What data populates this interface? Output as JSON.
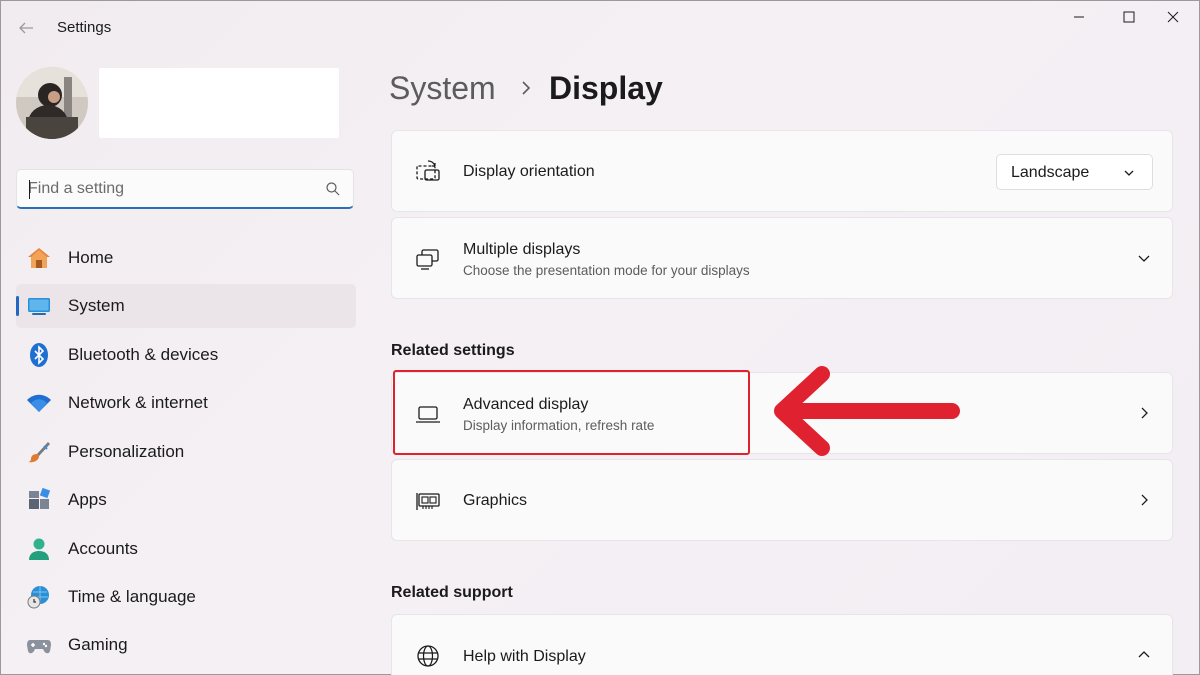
{
  "window": {
    "title": "Settings"
  },
  "search": {
    "placeholder": "Find a setting"
  },
  "sidebar": {
    "items": [
      {
        "label": "Home",
        "icon": "home-icon"
      },
      {
        "label": "System",
        "icon": "system-icon",
        "active": true
      },
      {
        "label": "Bluetooth & devices",
        "icon": "bluetooth-icon"
      },
      {
        "label": "Network & internet",
        "icon": "wifi-icon"
      },
      {
        "label": "Personalization",
        "icon": "brush-icon"
      },
      {
        "label": "Apps",
        "icon": "apps-icon"
      },
      {
        "label": "Accounts",
        "icon": "person-icon"
      },
      {
        "label": "Time & language",
        "icon": "globe-clock-icon"
      },
      {
        "label": "Gaming",
        "icon": "gamepad-icon"
      }
    ]
  },
  "breadcrumb": {
    "parent": "System",
    "current": "Display"
  },
  "cards": {
    "orientation": {
      "title": "Display orientation",
      "value": "Landscape"
    },
    "multiple": {
      "title": "Multiple displays",
      "subtitle": "Choose the presentation mode for your displays"
    },
    "advanced": {
      "title": "Advanced display",
      "subtitle": "Display information, refresh rate"
    },
    "graphics": {
      "title": "Graphics"
    },
    "help": {
      "title": "Help with Display"
    }
  },
  "sections": {
    "related_settings": "Related settings",
    "related_support": "Related support"
  },
  "colors": {
    "accent": "#2267c0",
    "annotation": "#e02130"
  }
}
